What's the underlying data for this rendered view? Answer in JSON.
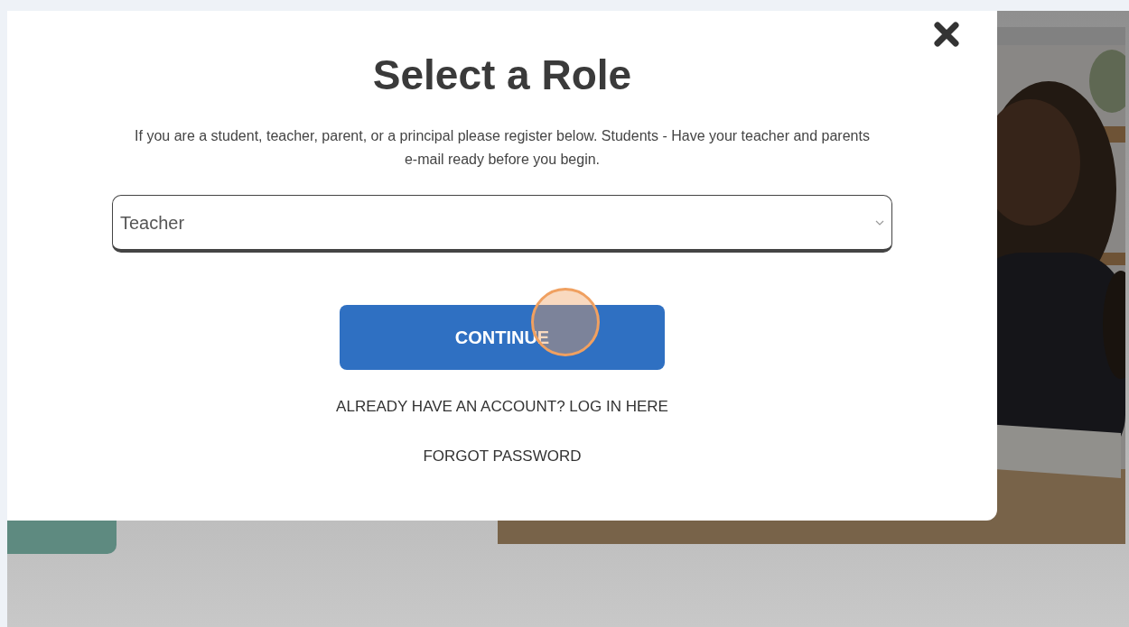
{
  "modal": {
    "title": "Select a Role",
    "description": "If you are a student, teacher, parent, or a principal please register below. Students - Have your teacher and parents e-mail ready before you begin.",
    "role_select": {
      "value": "Teacher"
    },
    "continue_button": "CONTINUE",
    "links": [
      "ALREADY HAVE AN ACCOUNT? LOG IN HERE",
      "FORGOT PASSWORD"
    ]
  }
}
